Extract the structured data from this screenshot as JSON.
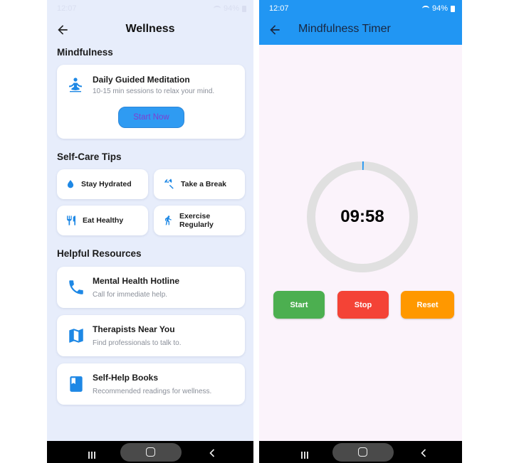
{
  "left_screen": {
    "status": {
      "time": "12:07",
      "battery": "94%"
    },
    "header": {
      "title": "Wellness"
    },
    "mindfulness": {
      "section_title": "Mindfulness",
      "card_title": "Daily Guided Meditation",
      "card_subtitle": "10-15 min sessions to relax your mind.",
      "button_label": "Start Now",
      "icon": "meditation-icon"
    },
    "self_care": {
      "section_title": "Self-Care Tips",
      "tips": [
        {
          "label": "Stay Hydrated",
          "icon": "water-drop-icon"
        },
        {
          "label": "Take a Break",
          "icon": "beach-umbrella-icon"
        },
        {
          "label": "Eat Healthy",
          "icon": "fork-knife-icon"
        },
        {
          "label": "Exercise Regularly",
          "icon": "running-icon"
        }
      ]
    },
    "resources": {
      "section_title": "Helpful Resources",
      "items": [
        {
          "title": "Mental Health Hotline",
          "subtitle": "Call for immediate help.",
          "icon": "phone-icon"
        },
        {
          "title": "Therapists Near You",
          "subtitle": "Find professionals to talk to.",
          "icon": "map-icon"
        },
        {
          "title": "Self-Help Books",
          "subtitle": "Recommended readings for wellness.",
          "icon": "book-icon"
        }
      ]
    }
  },
  "right_screen": {
    "status": {
      "time": "12:07",
      "battery": "94%"
    },
    "appbar": {
      "title": "Mindfulness Timer"
    },
    "timer": {
      "display": "09:58",
      "progress_fraction": 0.0033
    },
    "buttons": {
      "start": "Start",
      "stop": "Stop",
      "reset": "Reset"
    }
  },
  "colors": {
    "accent_blue": "#2196f3",
    "icon_blue": "#1e88e5",
    "start_green": "#4caf50",
    "stop_red": "#f44336",
    "reset_orange": "#ff9800"
  }
}
